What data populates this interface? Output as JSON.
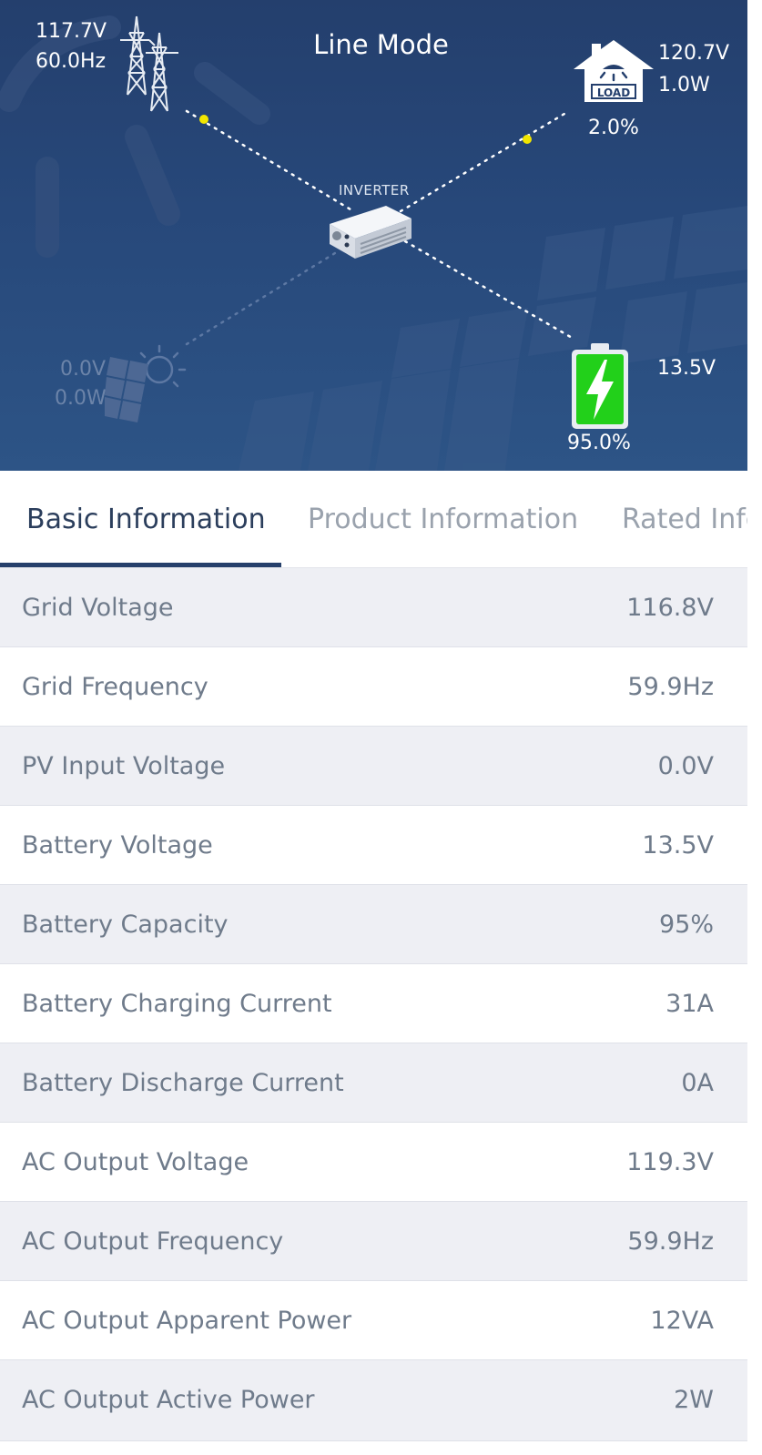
{
  "flow": {
    "mode": "Line Mode",
    "grid": {
      "voltage": "117.7V",
      "frequency": "60.0Hz"
    },
    "load": {
      "voltage": "120.7V",
      "power": "1.0W",
      "percent": "2.0%",
      "icon_text": "LOAD"
    },
    "inverter": {
      "label": "INVERTER"
    },
    "pv": {
      "voltage": "0.0V",
      "power": "0.0W"
    },
    "battery": {
      "voltage": "13.5V",
      "percent": "95.0%"
    },
    "colors": {
      "flow_dot": "#f2e600",
      "battery_fill": "#22d01a",
      "line_active": "#ffffff",
      "line_inactive": "#5d78a3"
    }
  },
  "tabs": [
    {
      "label": "Basic Information",
      "active": true
    },
    {
      "label": "Product Information",
      "active": false
    },
    {
      "label": "Rated Infor",
      "active": false
    }
  ],
  "basic_info": [
    {
      "label": "Grid Voltage",
      "value": "116.8V"
    },
    {
      "label": "Grid Frequency",
      "value": "59.9Hz"
    },
    {
      "label": "PV Input Voltage",
      "value": "0.0V"
    },
    {
      "label": "Battery Voltage",
      "value": "13.5V"
    },
    {
      "label": "Battery Capacity",
      "value": "95%"
    },
    {
      "label": "Battery Charging Current",
      "value": "31A"
    },
    {
      "label": "Battery Discharge Current",
      "value": "0A"
    },
    {
      "label": "AC Output Voltage",
      "value": "119.3V"
    },
    {
      "label": "AC Output Frequency",
      "value": "59.9Hz"
    },
    {
      "label": "AC Output Apparent Power",
      "value": "12VA"
    },
    {
      "label": "AC Output Active Power",
      "value": "2W"
    }
  ]
}
